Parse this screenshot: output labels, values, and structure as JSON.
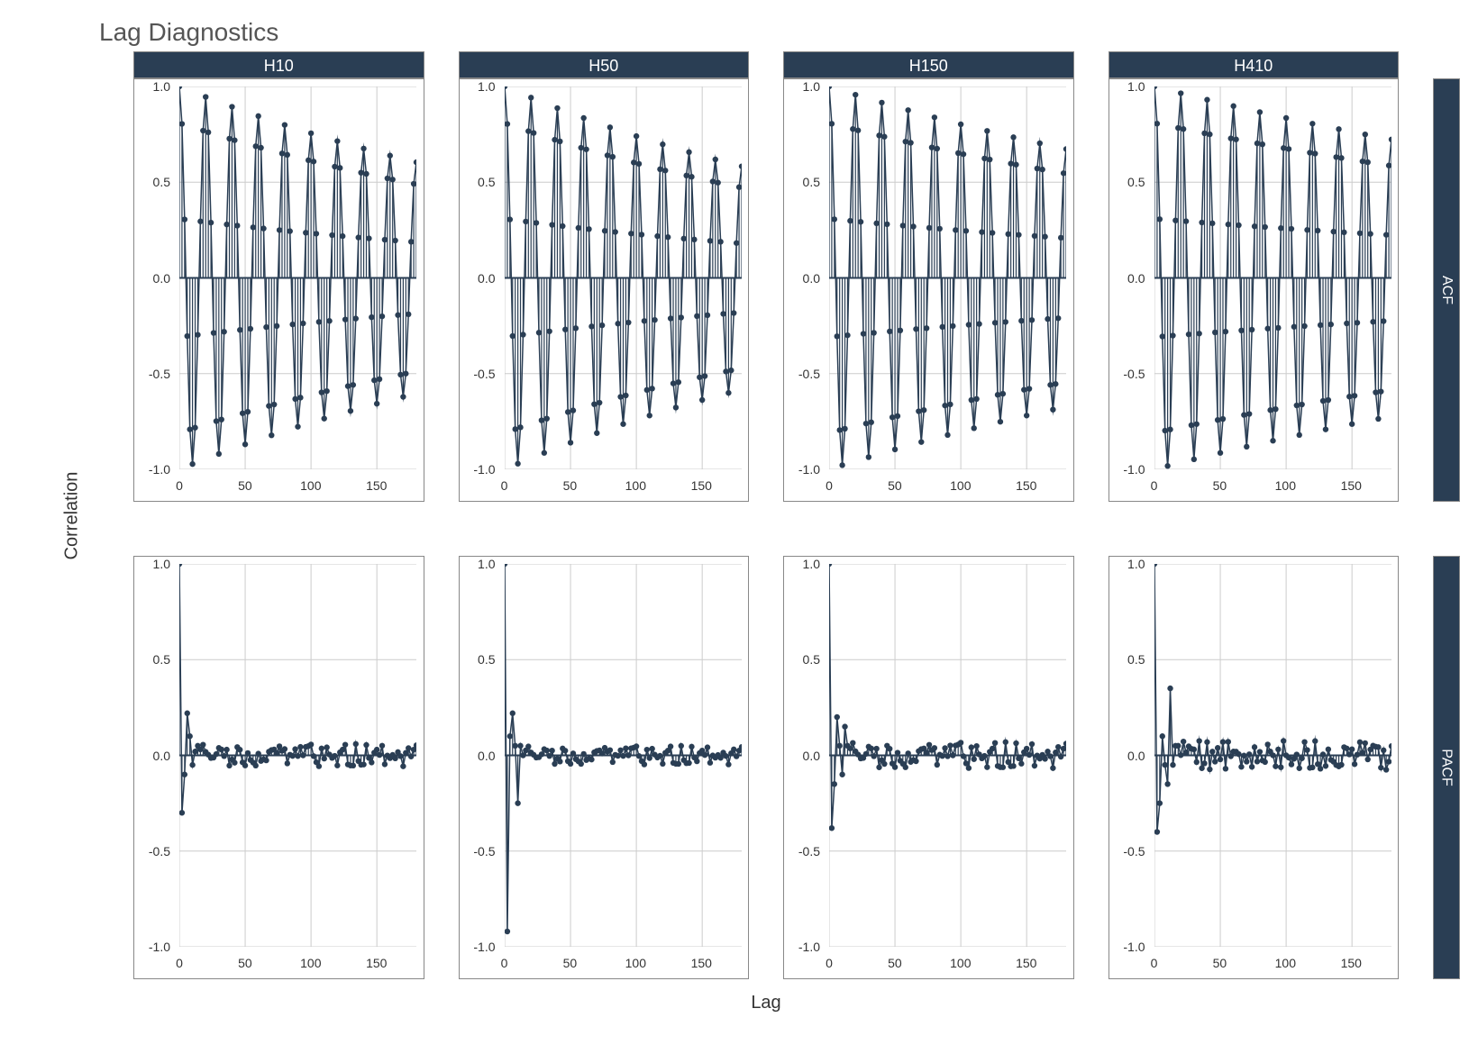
{
  "chart_data": {
    "title": "Lag Diagnostics",
    "xlabel": "Lag",
    "ylabel": "Correlation",
    "columns": [
      "H10",
      "H50",
      "H150",
      "H410"
    ],
    "rows": [
      "ACF",
      "PACF"
    ],
    "x_range": [
      0,
      180
    ],
    "y_range": [
      -1.0,
      1.0
    ],
    "x_ticks": [
      0,
      50,
      100,
      150
    ],
    "y_ticks": [
      -1.0,
      -0.5,
      0.0,
      0.5,
      1.0
    ],
    "point_color": "#2a3e54",
    "line_color": "#2a3e54",
    "series_params": {
      "ACF": {
        "H10": {
          "type": "damped_osc",
          "period": 20,
          "decay": 0.0028,
          "amp": 1.0,
          "baseline_drift": 0
        },
        "H50": {
          "type": "damped_osc",
          "period": 20,
          "decay": 0.003,
          "amp": 1.0,
          "baseline_drift": 0
        },
        "H150": {
          "type": "damped_osc",
          "period": 20,
          "decay": 0.0022,
          "amp": 1.0,
          "baseline_drift": 0
        },
        "H410": {
          "type": "damped_osc",
          "period": 20,
          "decay": 0.0018,
          "amp": 1.0,
          "baseline_drift": 0
        }
      },
      "PACF": {
        "H10": {
          "type": "pacf_like",
          "initial": [
            1.0,
            0.94,
            -0.3,
            -0.28,
            -0.1,
            0.05,
            0.22,
            0.18,
            0.1,
            0.05,
            -0.05,
            -0.08,
            0.02,
            0.18,
            0.05
          ],
          "noise": 0.06
        },
        "H50": {
          "type": "pacf_like",
          "initial": [
            1.0,
            0.98,
            -0.92,
            -0.05,
            0.1,
            0.05,
            0.22,
            0.18,
            0.05,
            -0.1,
            -0.25,
            0.02,
            0.05,
            0.03,
            0.0
          ],
          "noise": 0.05
        },
        "H150": {
          "type": "pacf_like",
          "initial": [
            1.0,
            0.9,
            -0.38,
            -0.3,
            -0.15,
            -0.05,
            0.2,
            0.1,
            0.05,
            0.02,
            -0.1,
            -0.05,
            0.15,
            0.1,
            0.05
          ],
          "noise": 0.07
        },
        "H410": {
          "type": "pacf_like",
          "initial": [
            1.0,
            0.8,
            -0.4,
            -0.38,
            -0.25,
            -0.15,
            0.1,
            0.05,
            -0.05,
            -0.2,
            -0.15,
            0.05,
            0.35,
            0.1,
            -0.05,
            -0.1,
            0.05,
            0.3,
            0.05
          ],
          "noise": 0.08
        }
      }
    }
  }
}
